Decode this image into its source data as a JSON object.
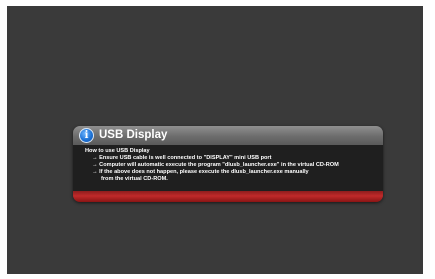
{
  "dialog": {
    "icon": "info-icon",
    "icon_glyph": "i",
    "title": "USB Display",
    "lines": [
      "How to use USB Display",
      "→ Ensure USB cable is well connected to \"DISPLAY\" mini USB port",
      "→ Computer will automatic execute the program \"dlusb_launcher.exe\" in the virtual CD-ROM",
      "→ If the above does not happen, please execute the dlusb_launcher.exe manually",
      "from the virtual CD-ROM."
    ]
  },
  "colors": {
    "screen_background": "#3a3a3a",
    "header": "#6c6c6c",
    "body": "#1f1f1f",
    "footer_accent": "#c02a2a",
    "icon": "#1e73d6"
  }
}
